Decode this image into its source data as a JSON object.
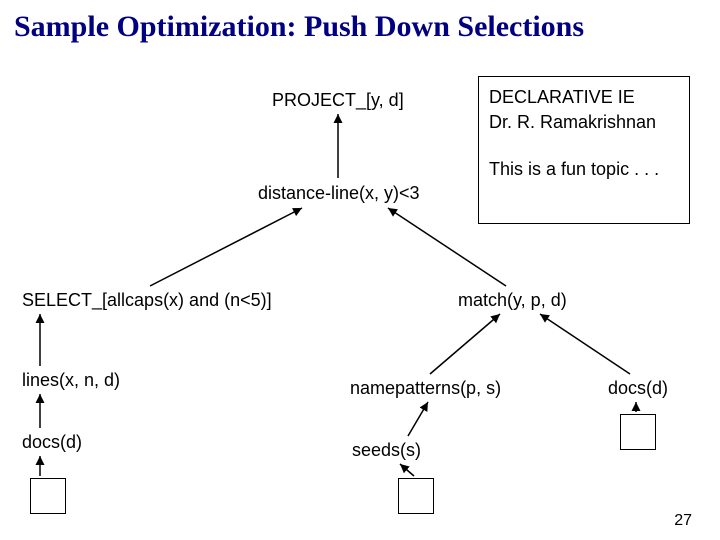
{
  "title": "Sample Optimization: Push Down Selections",
  "nodes": {
    "root": "PROJECT_[y, d]",
    "dist": "distance-line(x, y)<3",
    "select": "SELECT_[allcaps(x) and (n<5)]",
    "lines": "lines(x, n, d)",
    "docs1": "docs(d)",
    "match": "match(y, p, d)",
    "namepat": "namepatterns(p, s)",
    "docs2": "docs(d)",
    "seeds": "seeds(s)"
  },
  "info": {
    "line1": "DECLARATIVE IE",
    "line2": "Dr. R. Ramakrishnan",
    "line3": "This is a fun topic . . ."
  },
  "page": "27"
}
